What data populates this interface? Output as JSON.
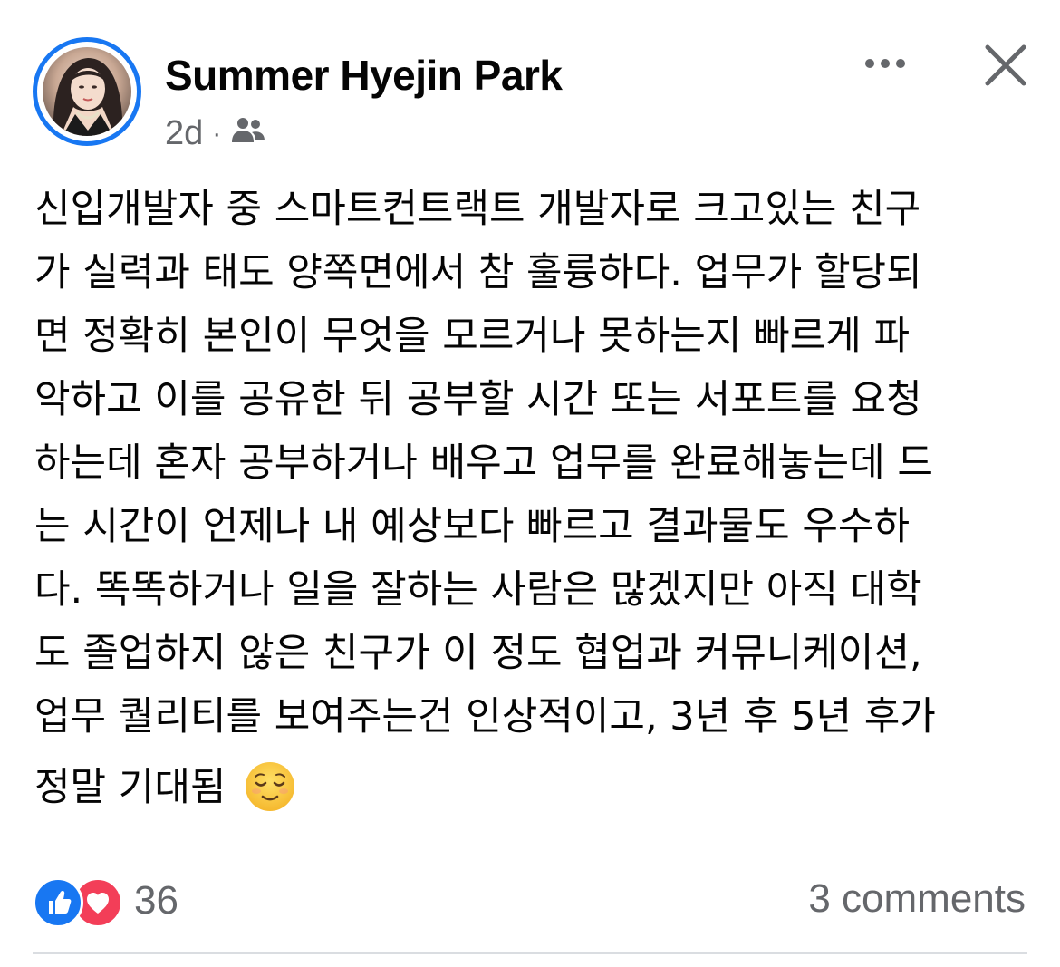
{
  "post": {
    "author": "Summer Hyejin Park",
    "time": "2d",
    "separator": "·",
    "audience_icon": "friends-icon",
    "lines": [
      "신입개발자 중 스마트컨트랙트 개발자로 크고있는 친구",
      "가 실력과 태도 양쪽면에서 참 훌륭하다. 업무가 할당되",
      "면 정확히 본인이 무엇을 모르거나 못하는지 빠르게 파",
      "악하고 이를 공유한 뒤 공부할 시간 또는 서포트를 요청",
      "하는데 혼자 공부하거나 배우고 업무를 완료해놓는데 드",
      "는 시간이 언제나 내 예상보다 빠르고 결과물도 우수하",
      "다. 똑똑하거나 일을 잘하는 사람은 많겠지만 아직 대학",
      "도 졸업하지 않은 친구가 이 정도 협업과 커뮤니케이션,",
      "업무 퀄리티를 보여주는건 인상적이고, 3년 후 5년 후가",
      "정말 기대됨"
    ],
    "emoji": "relieved-face"
  },
  "reactions": {
    "icons": [
      "like-icon",
      "love-icon"
    ],
    "count": "36"
  },
  "comments_label": "3 comments",
  "colors": {
    "accent": "#1877f2",
    "love": "#f33e58",
    "secondary_text": "#65676b",
    "divider": "#dadde1"
  }
}
